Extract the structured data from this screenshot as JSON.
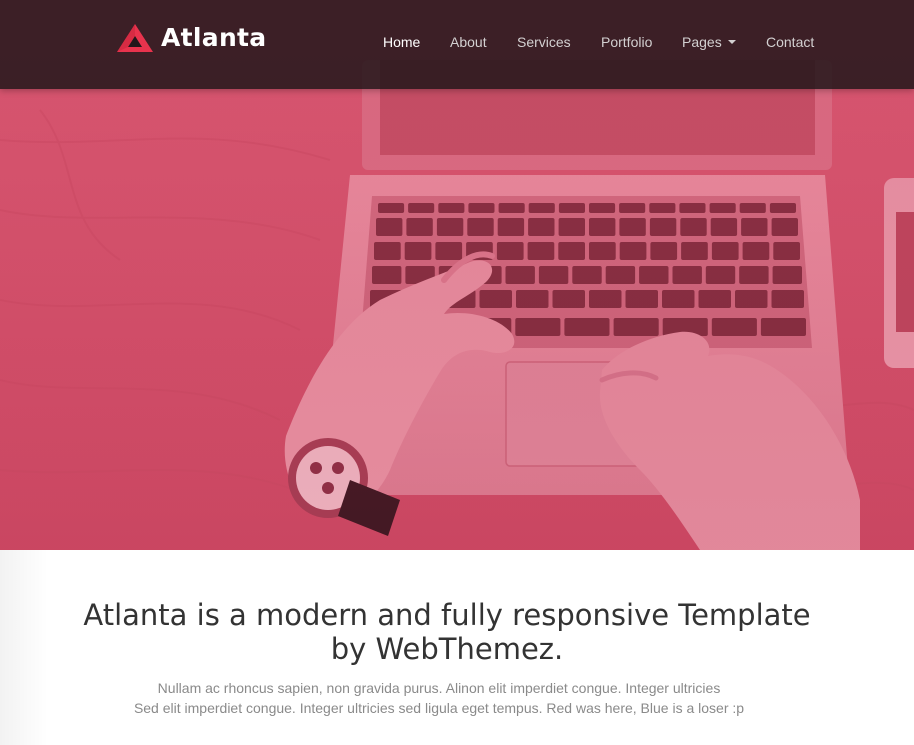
{
  "brand": {
    "name": "Atlanta",
    "logo_icon": "triangle-logo-icon",
    "accent": "#e8334d"
  },
  "navbar": {
    "items": [
      {
        "label": "Home",
        "active": true
      },
      {
        "label": "About"
      },
      {
        "label": "Services"
      },
      {
        "label": "Portfolio"
      },
      {
        "label": "Pages",
        "dropdown": true,
        "icon": "caret-down-icon"
      },
      {
        "label": "Contact"
      }
    ]
  },
  "hero": {
    "image": "hands-typing-on-laptop-photo",
    "overlay_color": "#e0506c"
  },
  "intro": {
    "headline_line1": "Atlanta is a modern and fully responsive Template",
    "headline_line2": "by WebThemez.",
    "lead_line1": "Nullam ac rhoncus sapien, non gravida purus. Alinon elit imperdiet congue. Integer ultricies",
    "lead_line2": "Sed elit imperdiet congue. Integer ultricies sed ligula eget tempus. Red was here, Blue is a loser :p"
  }
}
